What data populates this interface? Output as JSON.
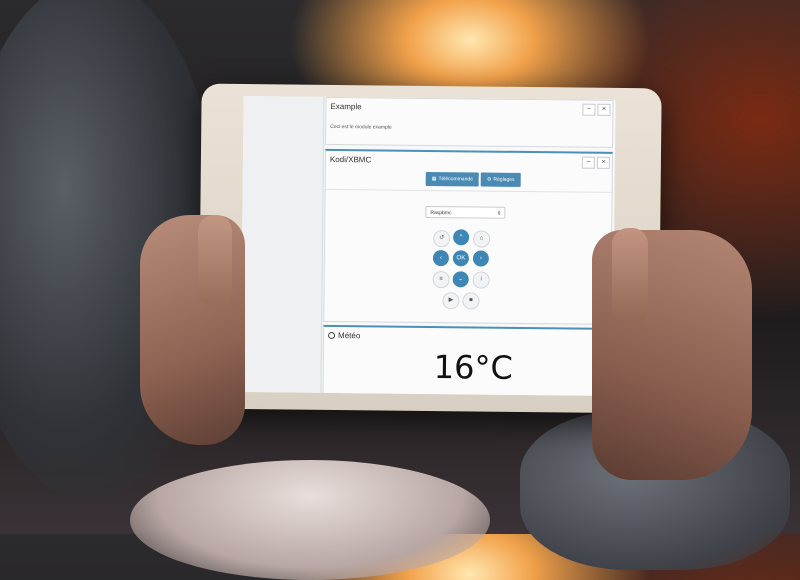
{
  "screen": {
    "example_panel": {
      "title": "Example",
      "description": "Ceci est le module example",
      "minimize": "−",
      "close": "×"
    },
    "kodi_panel": {
      "title": "Kodi/XBMC",
      "minimize": "−",
      "close": "×",
      "tabs": [
        {
          "label": "Télécommande",
          "icon": "remote-icon"
        },
        {
          "label": "Réglages",
          "icon": "gear-icon"
        }
      ],
      "device_select": "Raspbmc",
      "remote": {
        "back": "↺",
        "up": "^",
        "home": "⌂",
        "left": "‹",
        "ok": "OK",
        "right": "›",
        "menu": "≡",
        "down": "⌄",
        "info": "i",
        "play": "▶",
        "stop": "■"
      }
    },
    "meteo_panel": {
      "title": "Météo",
      "temperature": "16°C"
    }
  }
}
